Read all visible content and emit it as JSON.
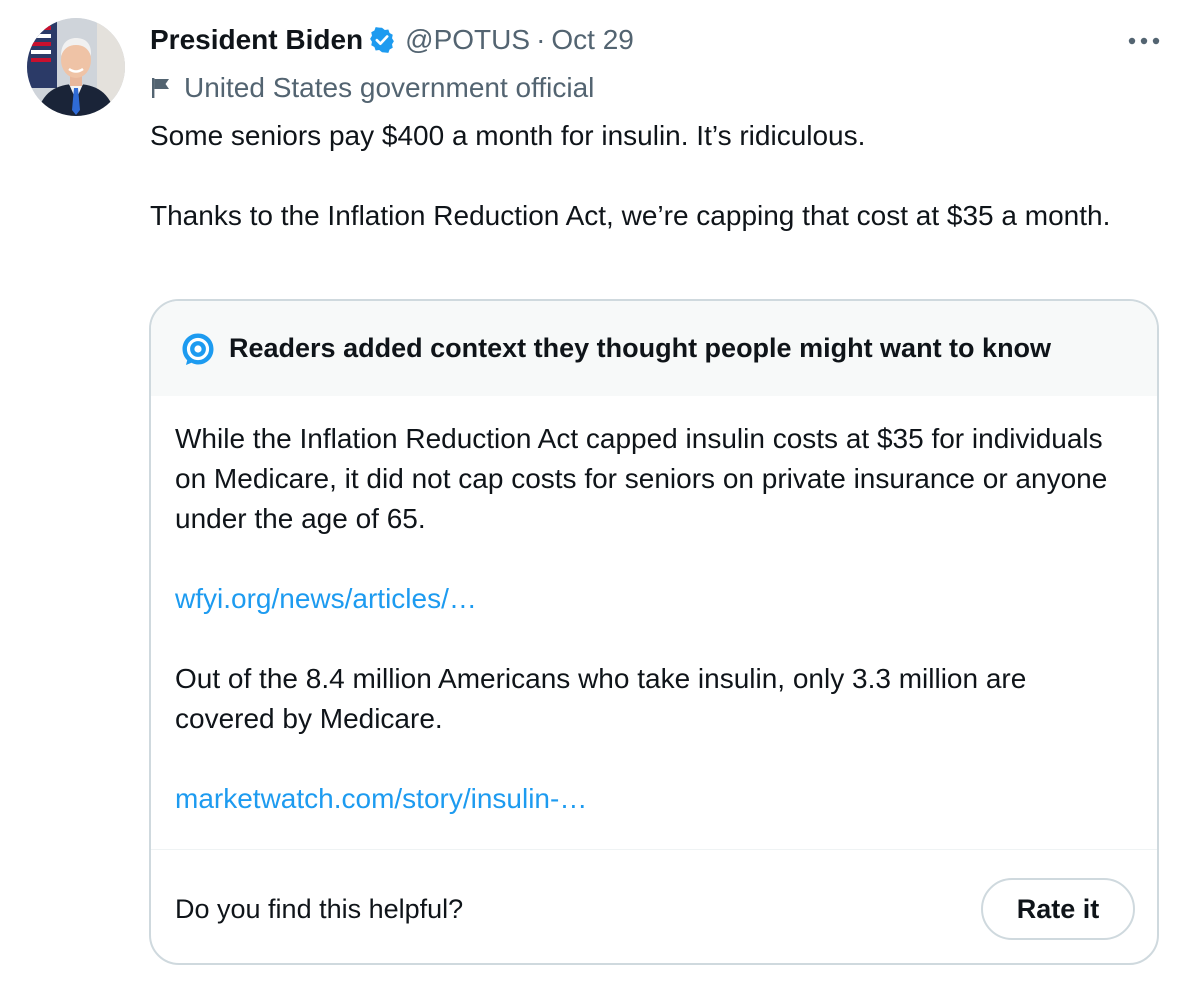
{
  "tweet": {
    "author_name": "President Biden",
    "handle": "@POTUS",
    "separator": "·",
    "date": "Oct 29",
    "account_label": "United States government official",
    "paragraphs": [
      "Some seniors pay $400 a month for insulin. It’s ridiculous.",
      "Thanks to the Inflation Reduction Act, we’re capping that cost at $35 a month."
    ]
  },
  "note": {
    "title": "Readers added context they thought people might want to know",
    "paragraph1": "While the Inflation Reduction Act capped insulin costs at $35 for individuals on Medicare, it did not cap costs for seniors on private insurance or anyone under the age of 65.",
    "link1": "wfyi.org/news/articles/…",
    "paragraph2": "Out of the 8.4 million Americans who take insulin, only 3.3 million are covered by Medicare.",
    "link2": "marketwatch.com/story/insulin-…",
    "helpful_question": "Do you find this helpful?",
    "rate_button": "Rate it"
  },
  "icons": {
    "verified": "verified-badge-icon",
    "more": "more-horizontal-icon",
    "flag": "flag-icon",
    "community_notes": "community-notes-icon"
  },
  "colors": {
    "accent": "#1d9bf0",
    "secondary_text": "#536471",
    "primary_text": "#0f1419",
    "border": "#cfd9de",
    "note_header_bg": "#f7f9f9"
  }
}
